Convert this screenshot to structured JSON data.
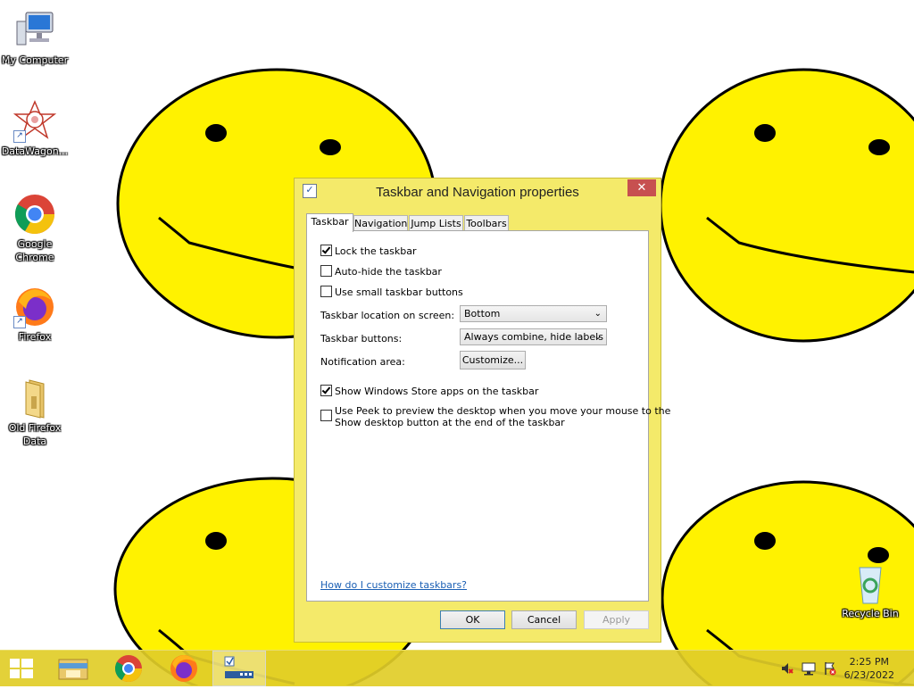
{
  "desktop": {
    "icons": [
      {
        "label": "My Computer",
        "icon": "computer-icon"
      },
      {
        "label": "DataWagon...",
        "icon": "datawagon-icon"
      },
      {
        "label": "Google Chrome",
        "icon": "chrome-icon"
      },
      {
        "label": "Firefox",
        "icon": "firefox-icon"
      },
      {
        "label": "Old Firefox Data",
        "icon": "folder-icon"
      },
      {
        "label": "Recycle Bin",
        "icon": "recycle-bin-icon"
      }
    ]
  },
  "dialog": {
    "title": "Taskbar and Navigation properties",
    "close_glyph": "✕",
    "tabs": [
      {
        "label": "Taskbar",
        "active": true
      },
      {
        "label": "Navigation",
        "active": false
      },
      {
        "label": "Jump Lists",
        "active": false
      },
      {
        "label": "Toolbars",
        "active": false
      }
    ],
    "options": {
      "lock_taskbar": {
        "label": "Lock the taskbar",
        "checked": true
      },
      "auto_hide": {
        "label": "Auto-hide the taskbar",
        "checked": false
      },
      "small_buttons": {
        "label": "Use small taskbar buttons",
        "checked": false
      }
    },
    "location": {
      "label": "Taskbar location on screen:",
      "value": "Bottom"
    },
    "buttons_setting": {
      "label": "Taskbar buttons:",
      "value": "Always combine, hide labels"
    },
    "notification": {
      "label": "Notification area:",
      "button": "Customize..."
    },
    "store_apps": {
      "label": "Show Windows Store apps on the taskbar",
      "checked": true
    },
    "peek": {
      "label_line1": "Use Peek to preview the desktop when you move your mouse to the",
      "label_line2": "Show desktop button at the end of the taskbar",
      "checked": false
    },
    "help_link": "How do I customize taskbars?",
    "ok": "OK",
    "cancel": "Cancel",
    "apply": "Apply"
  },
  "taskbar": {
    "items": [
      "start-icon",
      "file-explorer-icon",
      "chrome-icon",
      "firefox-icon",
      "taskbar-properties-icon"
    ],
    "clock": {
      "time": "2:25 PM",
      "date": "6/23/2022"
    },
    "tray": [
      "volume-muted-icon",
      "network-icon",
      "action-center-icon"
    ]
  },
  "colors": {
    "wallpaper_face": "#ffee00",
    "dialog_frame": "#f4ea6a",
    "taskbar": "#e1cd28",
    "close": "#c75050"
  }
}
